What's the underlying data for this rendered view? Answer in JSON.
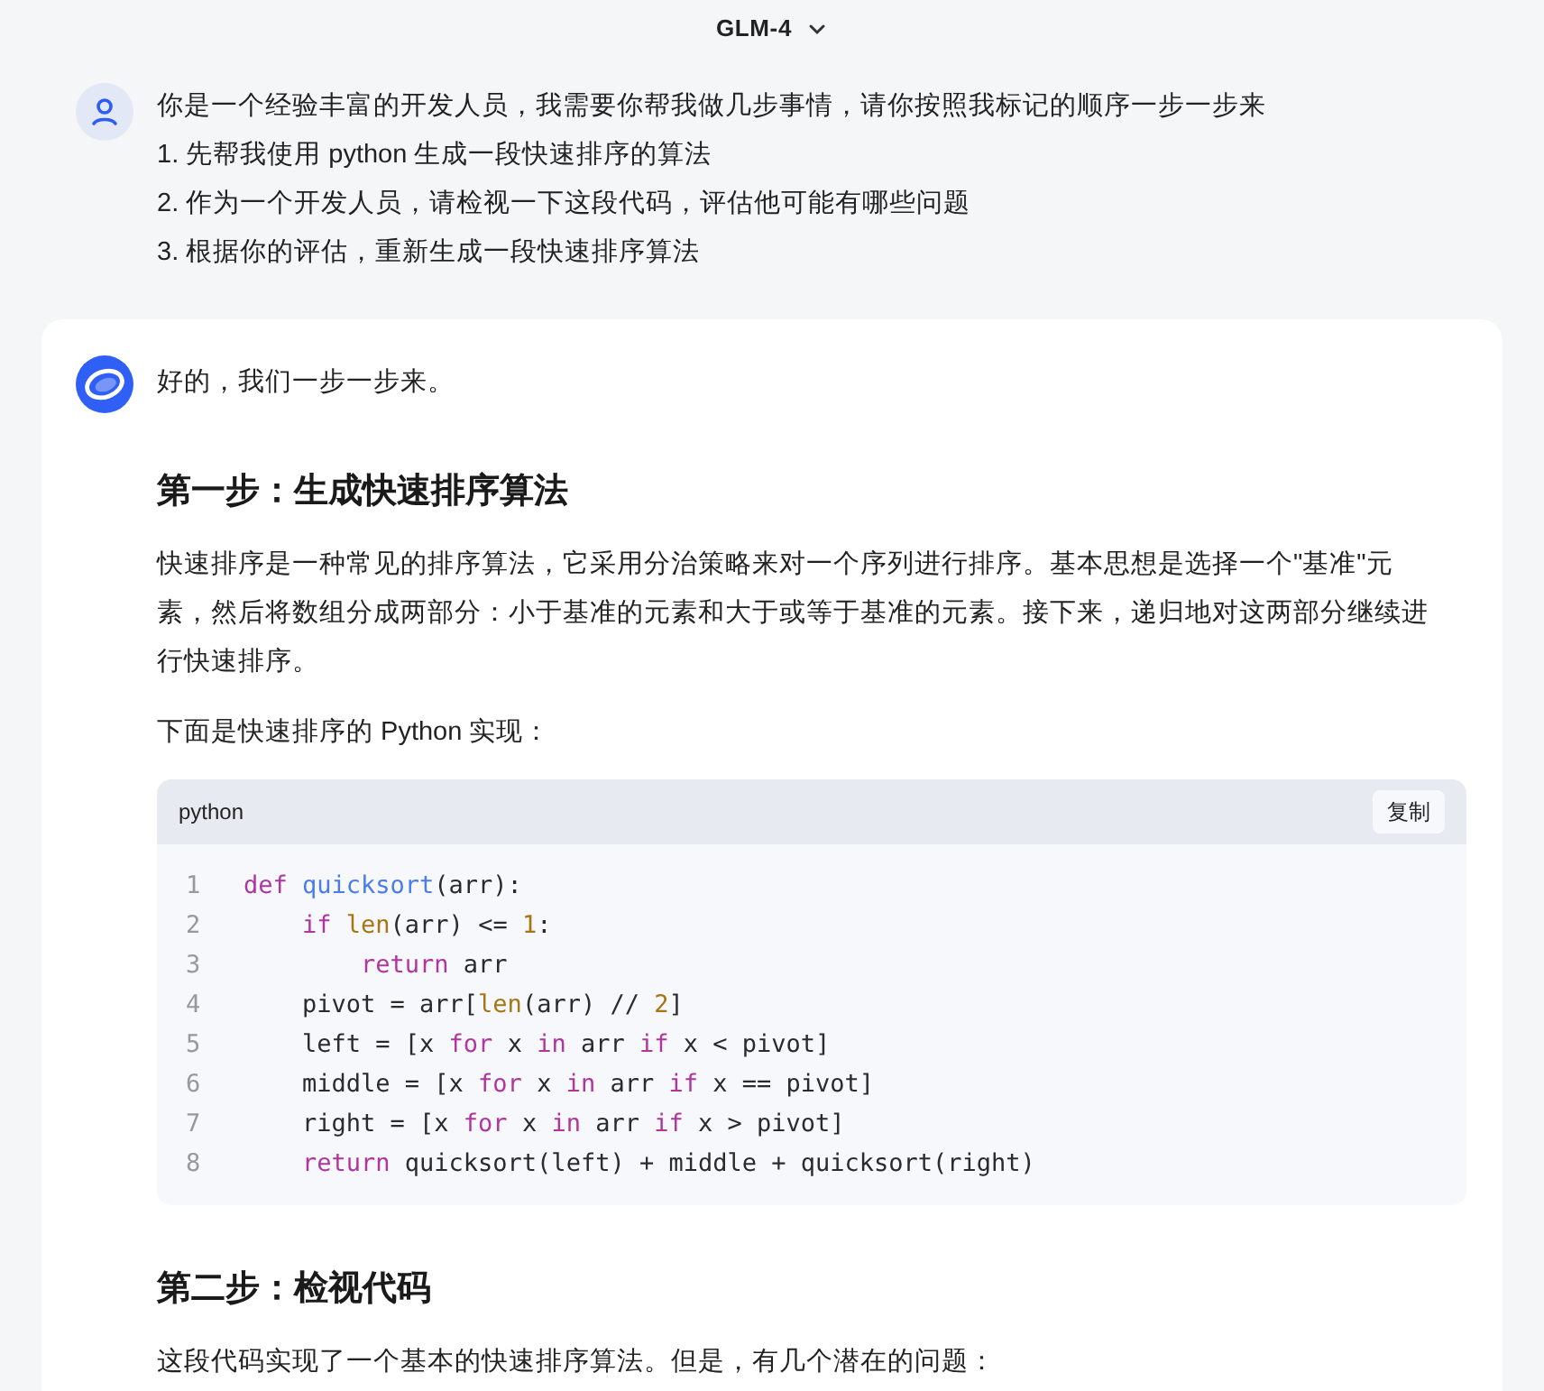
{
  "header": {
    "model": "GLM-4"
  },
  "user_message": {
    "lines": [
      "你是一个经验丰富的开发人员，我需要你帮我做几步事情，请你按照我标记的顺序一步一步来",
      "1. 先帮我使用 python 生成一段快速排序的算法",
      "2. 作为一个开发人员，请检视一下这段代码，评估他可能有哪些问题",
      "3. 根据你的评估，重新生成一段快速排序算法"
    ]
  },
  "assistant_message": {
    "blocks": [
      {
        "kind": "paragraph",
        "text": "好的，我们一步一步来。"
      },
      {
        "kind": "heading",
        "text": "第一步：生成快速排序算法"
      },
      {
        "kind": "paragraph",
        "text": "快速排序是一种常见的排序算法，它采用分治策略来对一个序列进行排序。基本思想是选择一个\"基准\"元素，然后将数组分成两部分：小于基准的元素和大于或等于基准的元素。接下来，递归地对这两部分继续进行快速排序。"
      },
      {
        "kind": "paragraph",
        "text": "下面是快速排序的 Python 实现："
      },
      {
        "kind": "code",
        "language": "python",
        "copy_label": "复制",
        "lines": [
          {
            "number": "1",
            "tokens": [
              {
                "kind": "keyword",
                "text": "def "
              },
              {
                "kind": "function",
                "text": "quicksort"
              },
              {
                "kind": "plain",
                "text": "(arr):"
              }
            ]
          },
          {
            "number": "2",
            "tokens": [
              {
                "kind": "keyword",
                "text": "    if "
              },
              {
                "kind": "builtin",
                "text": "len"
              },
              {
                "kind": "plain",
                "text": "(arr) <= "
              },
              {
                "kind": "number",
                "text": "1"
              },
              {
                "kind": "plain",
                "text": ":"
              }
            ]
          },
          {
            "number": "3",
            "tokens": [
              {
                "kind": "keyword",
                "text": "        return"
              },
              {
                "kind": "plain",
                "text": " arr"
              }
            ]
          },
          {
            "number": "4",
            "tokens": [
              {
                "kind": "plain",
                "text": "    pivot = arr["
              },
              {
                "kind": "builtin",
                "text": "len"
              },
              {
                "kind": "plain",
                "text": "(arr) // "
              },
              {
                "kind": "number",
                "text": "2"
              },
              {
                "kind": "plain",
                "text": "]"
              }
            ]
          },
          {
            "number": "5",
            "tokens": [
              {
                "kind": "plain",
                "text": "    left = [x "
              },
              {
                "kind": "keyword",
                "text": "for"
              },
              {
                "kind": "plain",
                "text": " x "
              },
              {
                "kind": "keyword",
                "text": "in"
              },
              {
                "kind": "plain",
                "text": " arr "
              },
              {
                "kind": "keyword",
                "text": "if"
              },
              {
                "kind": "plain",
                "text": " x < pivot]"
              }
            ]
          },
          {
            "number": "6",
            "tokens": [
              {
                "kind": "plain",
                "text": "    middle = [x "
              },
              {
                "kind": "keyword",
                "text": "for"
              },
              {
                "kind": "plain",
                "text": " x "
              },
              {
                "kind": "keyword",
                "text": "in"
              },
              {
                "kind": "plain",
                "text": " arr "
              },
              {
                "kind": "keyword",
                "text": "if"
              },
              {
                "kind": "plain",
                "text": " x == pivot]"
              }
            ]
          },
          {
            "number": "7",
            "tokens": [
              {
                "kind": "plain",
                "text": "    right = [x "
              },
              {
                "kind": "keyword",
                "text": "for"
              },
              {
                "kind": "plain",
                "text": " x "
              },
              {
                "kind": "keyword",
                "text": "in"
              },
              {
                "kind": "plain",
                "text": " arr "
              },
              {
                "kind": "keyword",
                "text": "if"
              },
              {
                "kind": "plain",
                "text": " x > pivot]"
              }
            ]
          },
          {
            "number": "8",
            "tokens": [
              {
                "kind": "keyword",
                "text": "    return"
              },
              {
                "kind": "plain",
                "text": " quicksort(left) + middle + quicksort(right)"
              }
            ]
          }
        ]
      },
      {
        "kind": "heading",
        "text": "第二步：检视代码"
      },
      {
        "kind": "paragraph",
        "text": "这段代码实现了一个基本的快速排序算法。但是，有几个潜在的问题："
      }
    ]
  }
}
